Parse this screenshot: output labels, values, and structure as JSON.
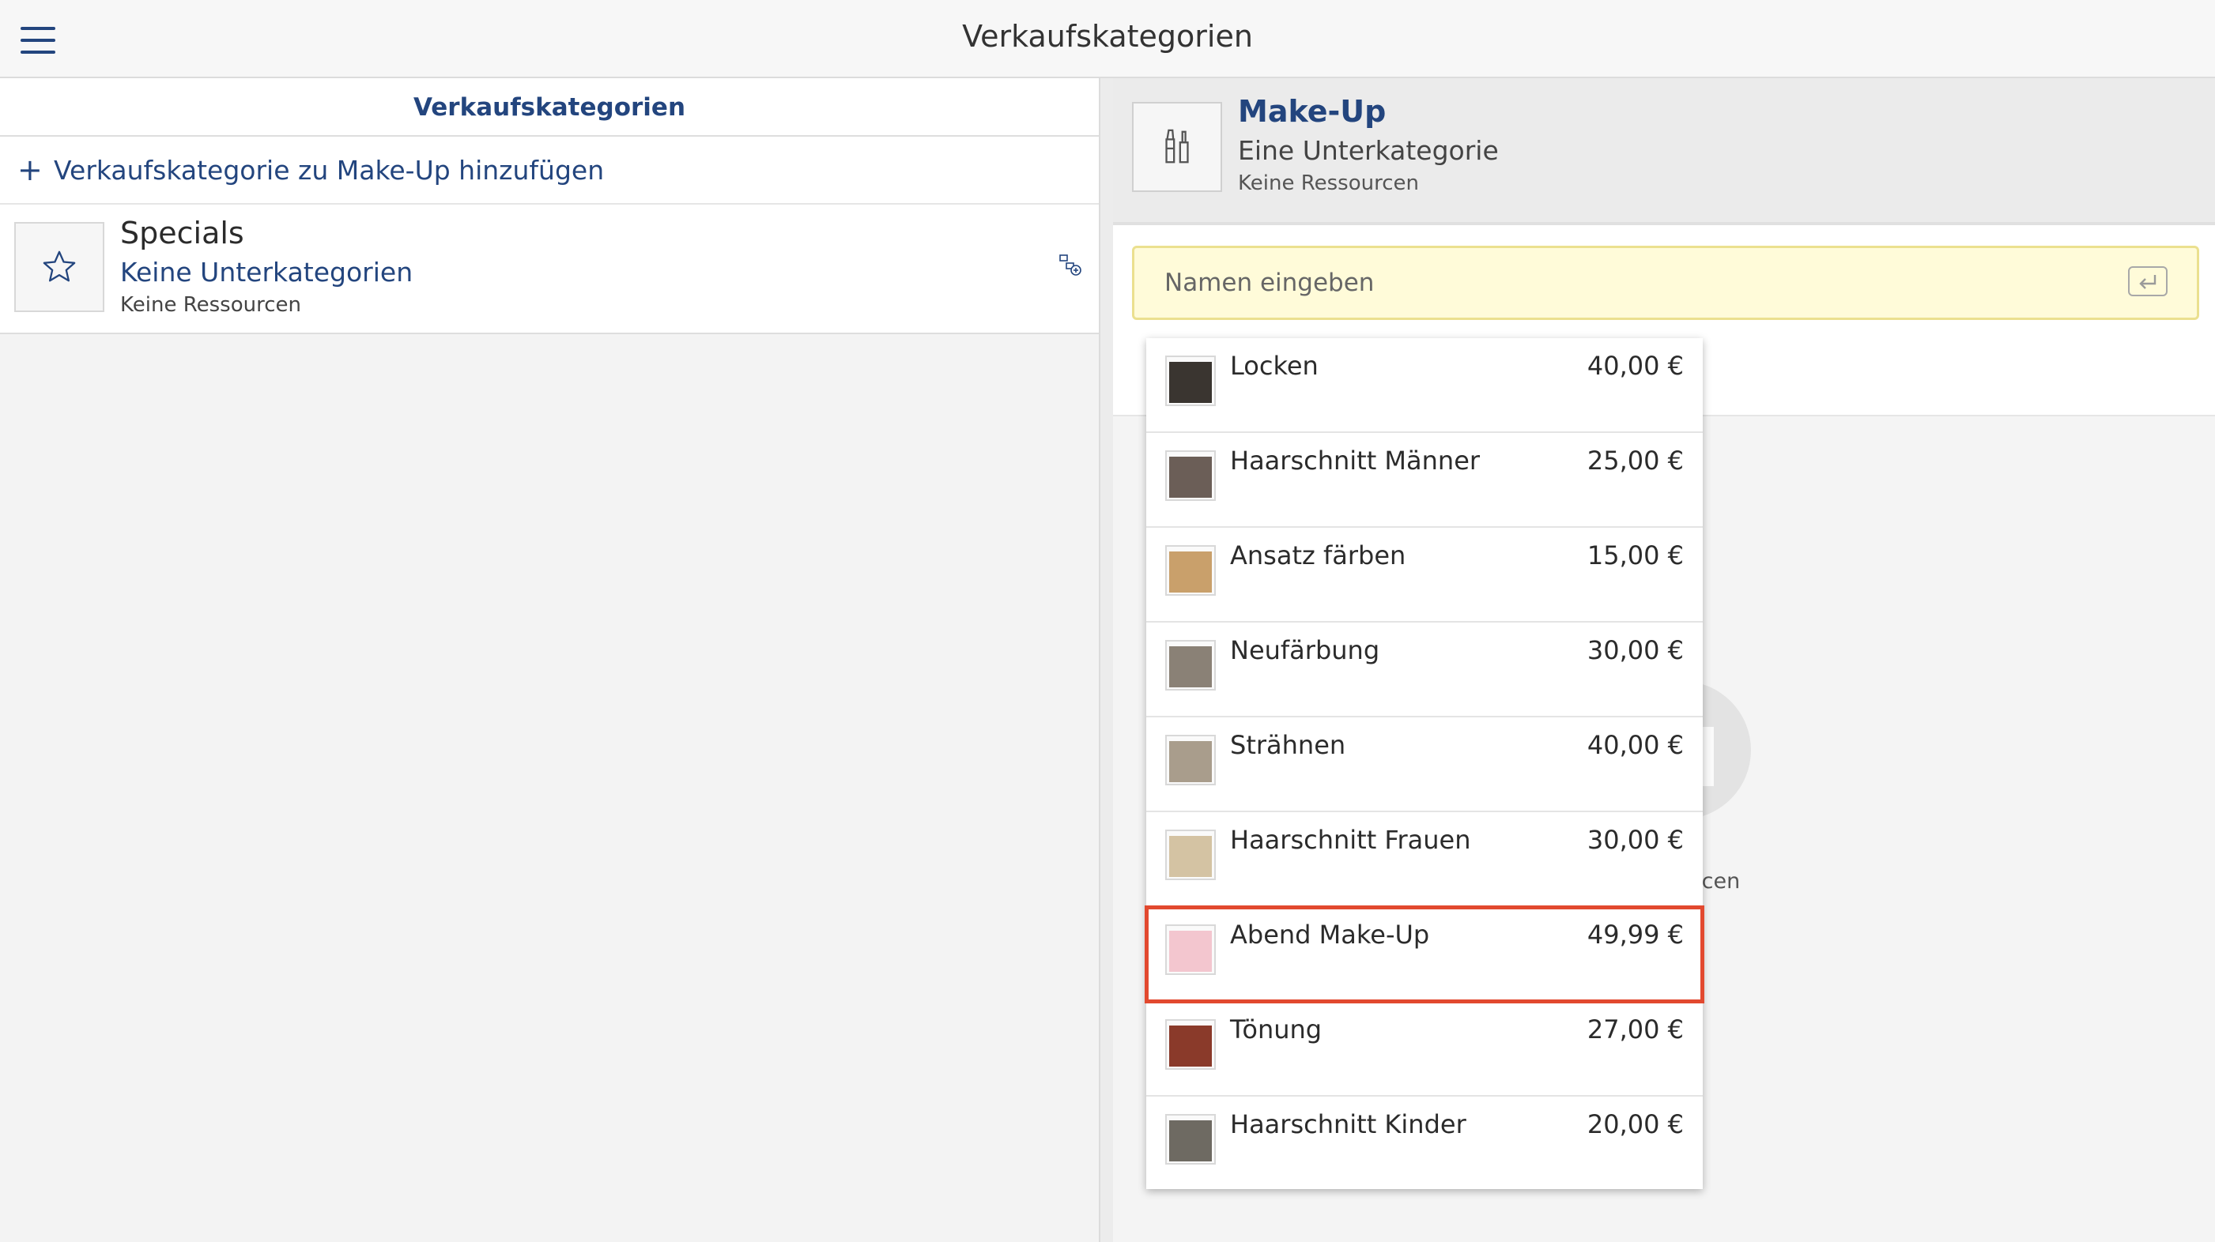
{
  "header": {
    "title": "Verkaufskategorien"
  },
  "left_panel": {
    "title": "Verkaufskategorien",
    "add_label": "Verkaufskategorie zu Make-Up hinzufügen",
    "categories": [
      {
        "name": "Specials",
        "subcategories": "Keine Unterkategorien",
        "resources": "Keine Ressourcen",
        "icon": "star-icon"
      }
    ]
  },
  "right_panel": {
    "category": {
      "title": "Make-Up",
      "subcategories": "Eine Unterkategorie",
      "resources": "Keine Ressourcen",
      "icon": "makeup-brush-icon"
    },
    "search": {
      "placeholder": "Namen eingeben"
    },
    "background_text": "urcen"
  },
  "dropdown": {
    "items": [
      {
        "name": "Locken",
        "price": "40,00 €",
        "thumb_color": "#3a3530"
      },
      {
        "name": "Haarschnitt Männer",
        "price": "25,00 €",
        "thumb_color": "#6b5e57"
      },
      {
        "name": "Ansatz färben",
        "price": "15,00 €",
        "thumb_color": "#c9a06b"
      },
      {
        "name": "Neufärbung",
        "price": "30,00 €",
        "thumb_color": "#8a8176"
      },
      {
        "name": "Strähnen",
        "price": "40,00 €",
        "thumb_color": "#a99d8c"
      },
      {
        "name": "Haarschnitt Frauen",
        "price": "30,00 €",
        "thumb_color": "#d4c3a3"
      },
      {
        "name": "Abend Make-Up",
        "price": "49,99 €",
        "thumb_color": "#f3c6cf",
        "highlighted": true
      },
      {
        "name": "Tönung",
        "price": "27,00 €",
        "thumb_color": "#8a3a2a"
      },
      {
        "name": "Haarschnitt Kinder",
        "price": "20,00 €",
        "thumb_color": "#6e6a62"
      }
    ]
  },
  "colors": {
    "accent": "#23457e",
    "highlight": "#e2492f",
    "search_bg": "#fffbd9"
  }
}
